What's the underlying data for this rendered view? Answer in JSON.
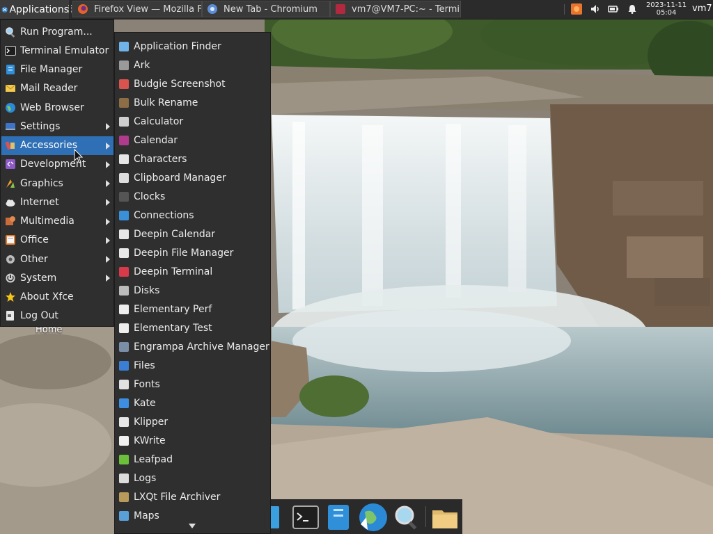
{
  "top_panel": {
    "applications_label": "Applications",
    "tasks": [
      {
        "label": "Firefox View — Mozilla F...",
        "icon": "firefox-icon"
      },
      {
        "label": "New Tab - Chromium",
        "icon": "chromium-icon"
      },
      {
        "label": "vm7@VM7-PC:~ - Termi...",
        "icon": "terminal-icon"
      }
    ],
    "clock": {
      "date": "2023-11-11",
      "time": "05:04"
    },
    "user": "vm7"
  },
  "main_menu": {
    "items": [
      {
        "label": "Run Program...",
        "icon": "run-program-icon",
        "submenu": false
      },
      {
        "label": "Terminal Emulator",
        "icon": "terminal-icon",
        "submenu": false
      },
      {
        "label": "File Manager",
        "icon": "file-manager-icon",
        "submenu": false
      },
      {
        "label": "Mail Reader",
        "icon": "mail-icon",
        "submenu": false
      },
      {
        "label": "Web Browser",
        "icon": "globe-icon",
        "submenu": false
      },
      {
        "label": "Settings",
        "icon": "settings-icon",
        "submenu": true
      },
      {
        "label": "Accessories",
        "icon": "accessories-icon",
        "submenu": true,
        "active": true
      },
      {
        "label": "Development",
        "icon": "development-icon",
        "submenu": true
      },
      {
        "label": "Graphics",
        "icon": "graphics-icon",
        "submenu": true
      },
      {
        "label": "Internet",
        "icon": "cloud-icon",
        "submenu": true
      },
      {
        "label": "Multimedia",
        "icon": "multimedia-icon",
        "submenu": true
      },
      {
        "label": "Office",
        "icon": "office-icon",
        "submenu": true
      },
      {
        "label": "Other",
        "icon": "other-icon",
        "submenu": true
      },
      {
        "label": "System",
        "icon": "system-icon",
        "submenu": true
      },
      {
        "label": "About Xfce",
        "icon": "star-icon",
        "submenu": false
      },
      {
        "label": "Log Out",
        "icon": "logout-icon",
        "submenu": false
      }
    ]
  },
  "accessories_menu": {
    "items": [
      {
        "label": "Application Finder",
        "icon": "app-finder-icon",
        "color": "#6fb3e8"
      },
      {
        "label": "Ark",
        "icon": "ark-icon",
        "color": "#9a9a9a"
      },
      {
        "label": "Budgie Screenshot",
        "icon": "screenshot-icon",
        "color": "#d9534f"
      },
      {
        "label": "Bulk Rename",
        "icon": "bulk-rename-icon",
        "color": "#8c6d46"
      },
      {
        "label": "Calculator",
        "icon": "calculator-icon",
        "color": "#cfcfcf"
      },
      {
        "label": "Calendar",
        "icon": "calendar-icon",
        "color": "#b03a8c"
      },
      {
        "label": "Characters",
        "icon": "characters-icon",
        "color": "#e6e6e6"
      },
      {
        "label": "Clipboard Manager",
        "icon": "clipboard-icon",
        "color": "#dddddd"
      },
      {
        "label": "Clocks",
        "icon": "clock-icon",
        "color": "#555555"
      },
      {
        "label": "Connections",
        "icon": "connections-icon",
        "color": "#3a8fd9"
      },
      {
        "label": "Deepin Calendar",
        "icon": "deepin-calendar-icon",
        "color": "#e8e8e8"
      },
      {
        "label": "Deepin File Manager",
        "icon": "deepin-file-manager-icon",
        "color": "#e8e8e8"
      },
      {
        "label": "Deepin Terminal",
        "icon": "deepin-terminal-icon",
        "color": "#d93a4a"
      },
      {
        "label": "Disks",
        "icon": "disks-icon",
        "color": "#bbbbbb"
      },
      {
        "label": "Elementary Perf",
        "icon": "elementary-perf-icon",
        "color": "#eeeeee"
      },
      {
        "label": "Elementary Test",
        "icon": "elementary-test-icon",
        "color": "#eeeeee"
      },
      {
        "label": "Engrampa Archive Manager",
        "icon": "archive-icon",
        "color": "#7a8fa6"
      },
      {
        "label": "Files",
        "icon": "files-icon",
        "color": "#3b7fd4"
      },
      {
        "label": "Fonts",
        "icon": "fonts-icon",
        "color": "#e0e0e0"
      },
      {
        "label": "Kate",
        "icon": "kate-icon",
        "color": "#3d8ee0"
      },
      {
        "label": "Klipper",
        "icon": "klipper-icon",
        "color": "#e6e6e6"
      },
      {
        "label": "KWrite",
        "icon": "kwrite-icon",
        "color": "#f0f0f0"
      },
      {
        "label": "Leafpad",
        "icon": "leafpad-icon",
        "color": "#6cbf3b"
      },
      {
        "label": "Logs",
        "icon": "logs-icon",
        "color": "#dcdcdc"
      },
      {
        "label": "LXQt File Archiver",
        "icon": "lxqt-archiver-icon",
        "color": "#b89a5a"
      },
      {
        "label": "Maps",
        "icon": "maps-icon",
        "color": "#5aa0d8"
      }
    ]
  },
  "desktop": {
    "home_label": "Home"
  },
  "dock": {
    "items": [
      {
        "icon": "blue-app-icon"
      },
      {
        "icon": "terminal-icon"
      },
      {
        "icon": "file-manager-icon"
      },
      {
        "icon": "web-browser-icon"
      },
      {
        "icon": "app-finder-icon"
      },
      {
        "icon": "folder-icon"
      }
    ]
  }
}
